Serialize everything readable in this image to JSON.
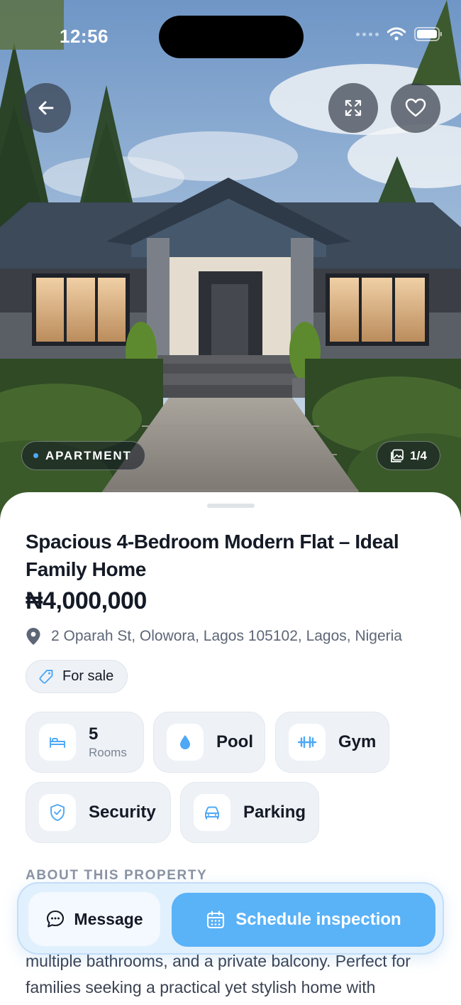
{
  "status_bar": {
    "time": "12:56"
  },
  "hero": {
    "property_type": "APARTMENT",
    "photo_counter": "1/4",
    "icons": [
      "back-arrow-icon",
      "expand-icon",
      "heart-icon",
      "gallery-icon"
    ]
  },
  "listing": {
    "title": "Spacious 4-Bedroom Modern Flat – Ideal Family Home",
    "price": "₦4,000,000",
    "address": "2 Oparah St, Olowora, Lagos 105102, Lagos, Nigeria",
    "listing_tag": "For sale"
  },
  "features": {
    "rooms_count": "5",
    "rooms_label": "Rooms",
    "pool": "Pool",
    "gym": "Gym",
    "security": "Security",
    "parking": "Parking"
  },
  "about": {
    "heading": "ABOUT THIS PROPERTY",
    "description": "multiple bathrooms, and a private balcony. Perfect for families seeking a practical yet stylish home with"
  },
  "actions": {
    "message_label": "Message",
    "schedule_label": "Schedule inspection"
  },
  "colors": {
    "accent": "#5ab2f7",
    "text_primary": "#141a26",
    "text_secondary": "#5d6676",
    "chip_bg": "#eef2f6"
  }
}
